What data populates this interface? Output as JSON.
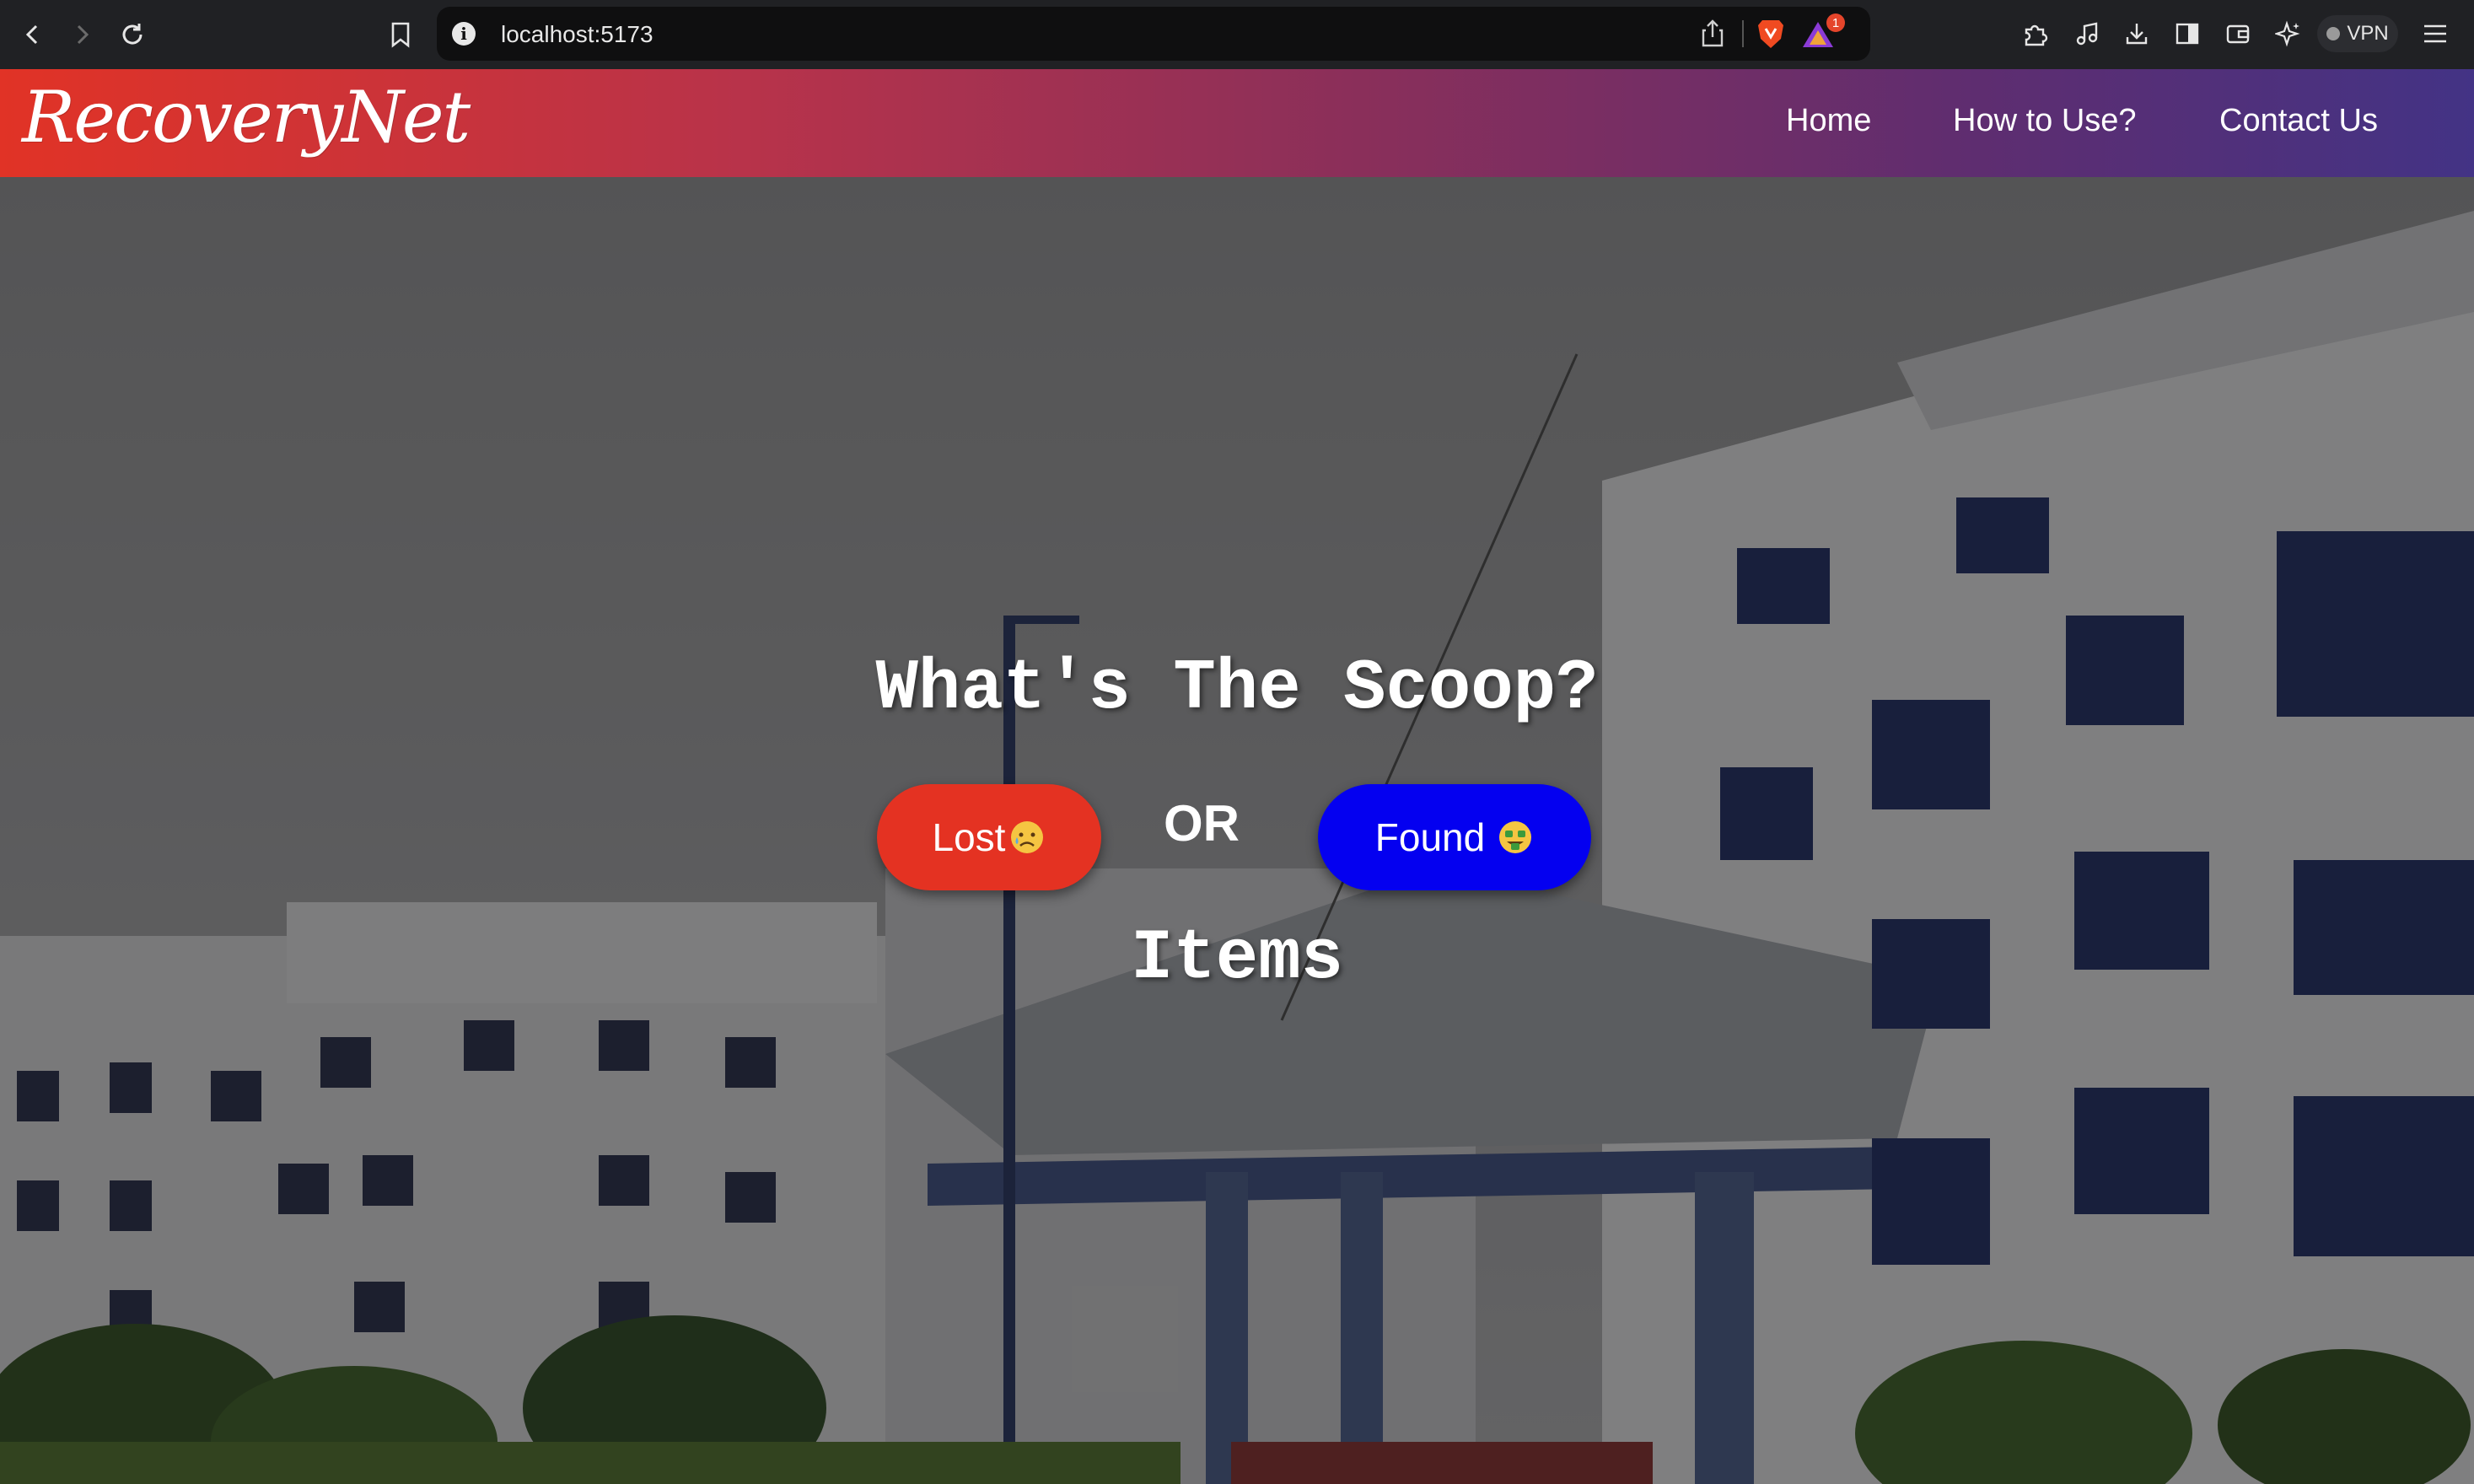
{
  "browser": {
    "url": "localhost:5173",
    "rewards_badge": "1",
    "vpn_label": "VPN",
    "icons": [
      "back-icon",
      "forward-icon",
      "reload-icon",
      "bookmark-icon",
      "site-info-icon",
      "share-icon",
      "brave-shield-icon",
      "brave-rewards-icon",
      "extensions-icon",
      "media-icon",
      "downloads-icon",
      "sidebar-icon",
      "wallet-icon",
      "leo-ai-icon",
      "menu-icon"
    ]
  },
  "site": {
    "logo": "RecoveryNet",
    "nav": [
      "Home",
      "How to Use?",
      "Contact Us"
    ]
  },
  "hero": {
    "headline": "What's The Scoop?",
    "lost_label": "Lost",
    "or_label": "OR",
    "found_label": "Found",
    "items_label": "Items"
  },
  "colors": {
    "header_gradient_start": "#e13326",
    "header_gradient_end": "#433385",
    "lost_button": "#e43222",
    "found_button": "#0400f0"
  }
}
